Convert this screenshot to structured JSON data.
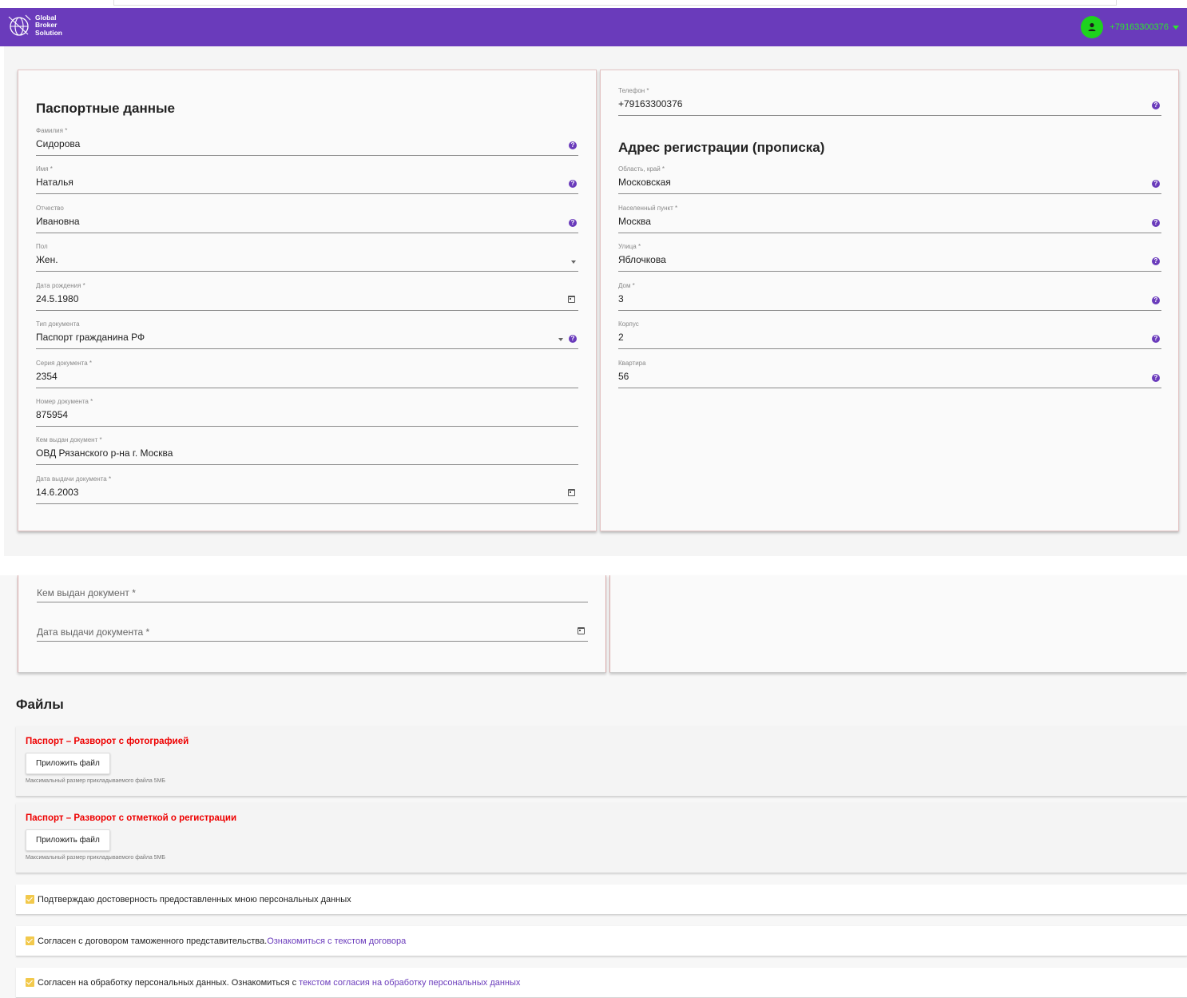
{
  "header": {
    "logo_lines": [
      "Global",
      "Broker",
      "Solution"
    ],
    "user_phone": "+79163300376",
    "colors": {
      "bar": "#6a3bbb",
      "avatar": "#1ed21e",
      "phone": "#2ee62e"
    }
  },
  "passport": {
    "title": "Паспортные данные",
    "fields": [
      {
        "label": "Фамилия *",
        "value": "Сидорова"
      },
      {
        "label": "Имя *",
        "value": "Наталья"
      },
      {
        "label": "Отчество",
        "value": "Ивановна"
      },
      {
        "label": "Пол",
        "value": "Жен."
      },
      {
        "label": "Дата рождения *",
        "value": "24.5.1980"
      },
      {
        "label": "Тип документа",
        "value": "Паспорт гражданина РФ"
      },
      {
        "label": "Серия документа *",
        "value": "2354"
      },
      {
        "label": "Номер документа *",
        "value": "875954"
      },
      {
        "label": "Кем выдан документ *",
        "value": "ОВД Рязанского р-на г. Москва"
      },
      {
        "label": "Дата выдачи документа *",
        "value": "14.6.2003"
      }
    ]
  },
  "contact": {
    "phone_label": "Телефон *",
    "phone_value": "+79163300376"
  },
  "address": {
    "title": "Адрес регистрации (прописка)",
    "fields": [
      {
        "label": "Область, край *",
        "value": "Московская"
      },
      {
        "label": "Населенный пункт *",
        "value": "Москва"
      },
      {
        "label": "Улица *",
        "value": "Яблочкова"
      },
      {
        "label": "Дом *",
        "value": "3"
      },
      {
        "label": "Корпус",
        "value": "2"
      },
      {
        "label": "Квартира",
        "value": "56"
      }
    ]
  },
  "second_view": {
    "issued_by_placeholder": "Кем выдан документ *",
    "issue_date_placeholder": "Дата выдачи документа *"
  },
  "files": {
    "title": "Файлы",
    "items": [
      {
        "title": "Паспорт – Разворот с фотографией",
        "button": "Приложить файл",
        "note": "Максимальный размер прикладываемого файла 5МБ"
      },
      {
        "title": "Паспорт – Разворот с отметкой о регистрации",
        "button": "Приложить файл",
        "note": "Максимальный размер прикладываемого файла 5МБ"
      }
    ]
  },
  "agreements": [
    {
      "text": "Подтверждаю достоверность предоставленных мною персональных данных",
      "link": ""
    },
    {
      "text": "Согласен с договором таможенного представительства.",
      "link": "Ознакомиться с текстом договора"
    },
    {
      "text": "Согласен на обработку персональных данных. Ознакомиться с",
      "link": "текстом согласия на обработку персональных данных"
    }
  ],
  "colors": {
    "accent": "#6a3bbb",
    "required_file": "#ee0000",
    "checkbox": "#f2c94c"
  }
}
